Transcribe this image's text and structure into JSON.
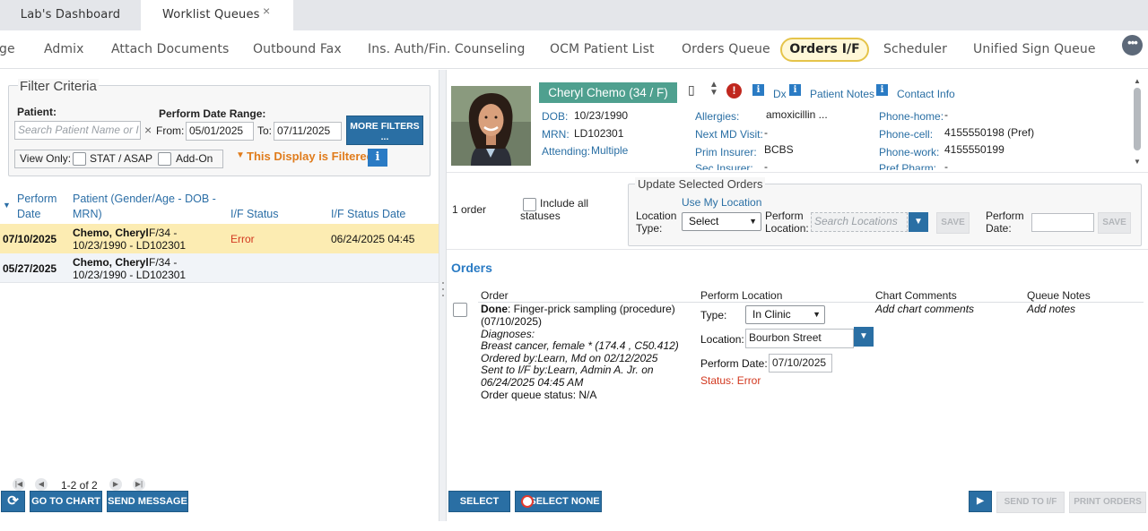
{
  "tabs": {
    "lab": "Lab's Dashboard",
    "worklist": "Worklist Queues",
    "close": "×"
  },
  "nav": {
    "items": [
      "ge",
      "Admix",
      "Attach Documents",
      "Outbound Fax",
      "Ins. Auth/Fin. Counseling",
      "OCM Patient List",
      "Orders Queue",
      "Orders I/F",
      "Scheduler",
      "Unified Sign Queue"
    ],
    "more": "•••"
  },
  "filter": {
    "title": "Filter Criteria",
    "patient_label": "Patient:",
    "patient_placeholder": "Search Patient Name or I",
    "clear": "×",
    "date_label": "Perform Date Range:",
    "from_label": "From:",
    "from_value": "05/01/2025",
    "to_label": "To:",
    "to_value": "07/11/2025",
    "more_filters": "MORE FILTERS",
    "more_filters_2": "...",
    "view_only": "View Only:",
    "stat": "STAT / ASAP",
    "addon": "Add-On",
    "filtered_msg": "This Display is Filtered",
    "filter_icon": "▼",
    "info": "i"
  },
  "worklist": {
    "headers": {
      "date1": "Perform",
      "date2": "Date",
      "patient1": "Patient (Gender/Age - DOB -",
      "patient2": "MRN)",
      "status": "I/F Status",
      "status_date": "I/F Status Date"
    },
    "rows": [
      {
        "date": "07/10/2025",
        "name": "Chemo, Cheryl",
        "age": " F/34 -",
        "dob": "10/23/1990 - LD102301",
        "status": "Error",
        "status_date": "06/24/2025 04:45"
      },
      {
        "date": "05/27/2025",
        "name": "Chemo, Cheryl",
        "age": " F/34 -",
        "dob": "10/23/1990 - LD102301",
        "status": "",
        "status_date": ""
      }
    ],
    "pager": "1-2 of 2",
    "go_to_chart": "GO TO CHART",
    "send_message": "SEND MESSAGE",
    "refresh": "⟳"
  },
  "patient": {
    "name": "Cheryl Chemo (34 / F)",
    "dob_label": "DOB:",
    "dob": "10/23/1990",
    "mrn_label": "MRN:",
    "mrn": "LD102301",
    "attending_label": "Attending:",
    "attending": "Multiple",
    "allergies_label": "Allergies:",
    "allergies": "amoxicillin ...",
    "next_md_label": "Next MD Visit:",
    "next_md": "-",
    "prim_ins_label": "Prim Insurer:",
    "prim_ins": "BCBS",
    "sec_ins_label": "Sec Insurer:",
    "sec_ins": "-",
    "phone_home_label": "Phone-home:",
    "phone_home": "-",
    "phone_cell_label": "Phone-cell:",
    "phone_cell": "4155550198 (Pref)",
    "phone_work_label": "Phone-work:",
    "phone_work": "4155550199",
    "pref_pharm_label": "Pref Pharm:",
    "pref_pharm": "-",
    "dx": "Dx",
    "patient_notes": "Patient Notes",
    "contact_info": "Contact Info",
    "alert": "!"
  },
  "update": {
    "count": "1 order",
    "include_all": "Include all",
    "statuses": "statuses",
    "title": "Update Selected Orders",
    "use_my_location": "Use My Location",
    "loc_type_label1": "Location",
    "loc_type_label2": "Type:",
    "loc_type_value": "Select",
    "perform_loc_label1": "Perform",
    "perform_loc_label2": "Location:",
    "perform_loc_placeholder": "Search Locations",
    "save": "SAVE",
    "perform_date_label1": "Perform",
    "perform_date_label2": "Date:"
  },
  "orders": {
    "title": "Orders",
    "h_order": "Order",
    "h_perform_loc": "Perform Location",
    "h_chart_comments": "Chart Comments",
    "h_queue_notes": "Queue Notes",
    "item": {
      "done": "Done",
      "desc1": ": Finger-prick sampling (procedure)",
      "desc2": "(07/10/2025)",
      "diag_label": "Diagnoses:",
      "diag": "Breast cancer, female * (174.4 , C50.412)",
      "ordered_by": "Ordered by:Learn, Md on 02/12/2025",
      "sent_by1": "Sent to I/F by:Learn, Admin A. Jr. on",
      "sent_by2": "06/24/2025 04:45 AM",
      "queue_status": "Order queue status: N/A",
      "type_label": "Type:",
      "type_value": "In Clinic",
      "location_label": "Location:",
      "location_value": "Bourbon Street",
      "perform_date_label": "Perform Date:",
      "perform_date_value": "07/10/2025",
      "status": "Status: Error",
      "add_chart_comments": "Add chart comments",
      "add_notes": "Add notes"
    },
    "select_all": "SELECT ALL",
    "select_none": "SELECT NONE",
    "send_to_if": "SEND TO I/F",
    "print_orders": "PRINT ORDERS",
    "play": "▶"
  }
}
